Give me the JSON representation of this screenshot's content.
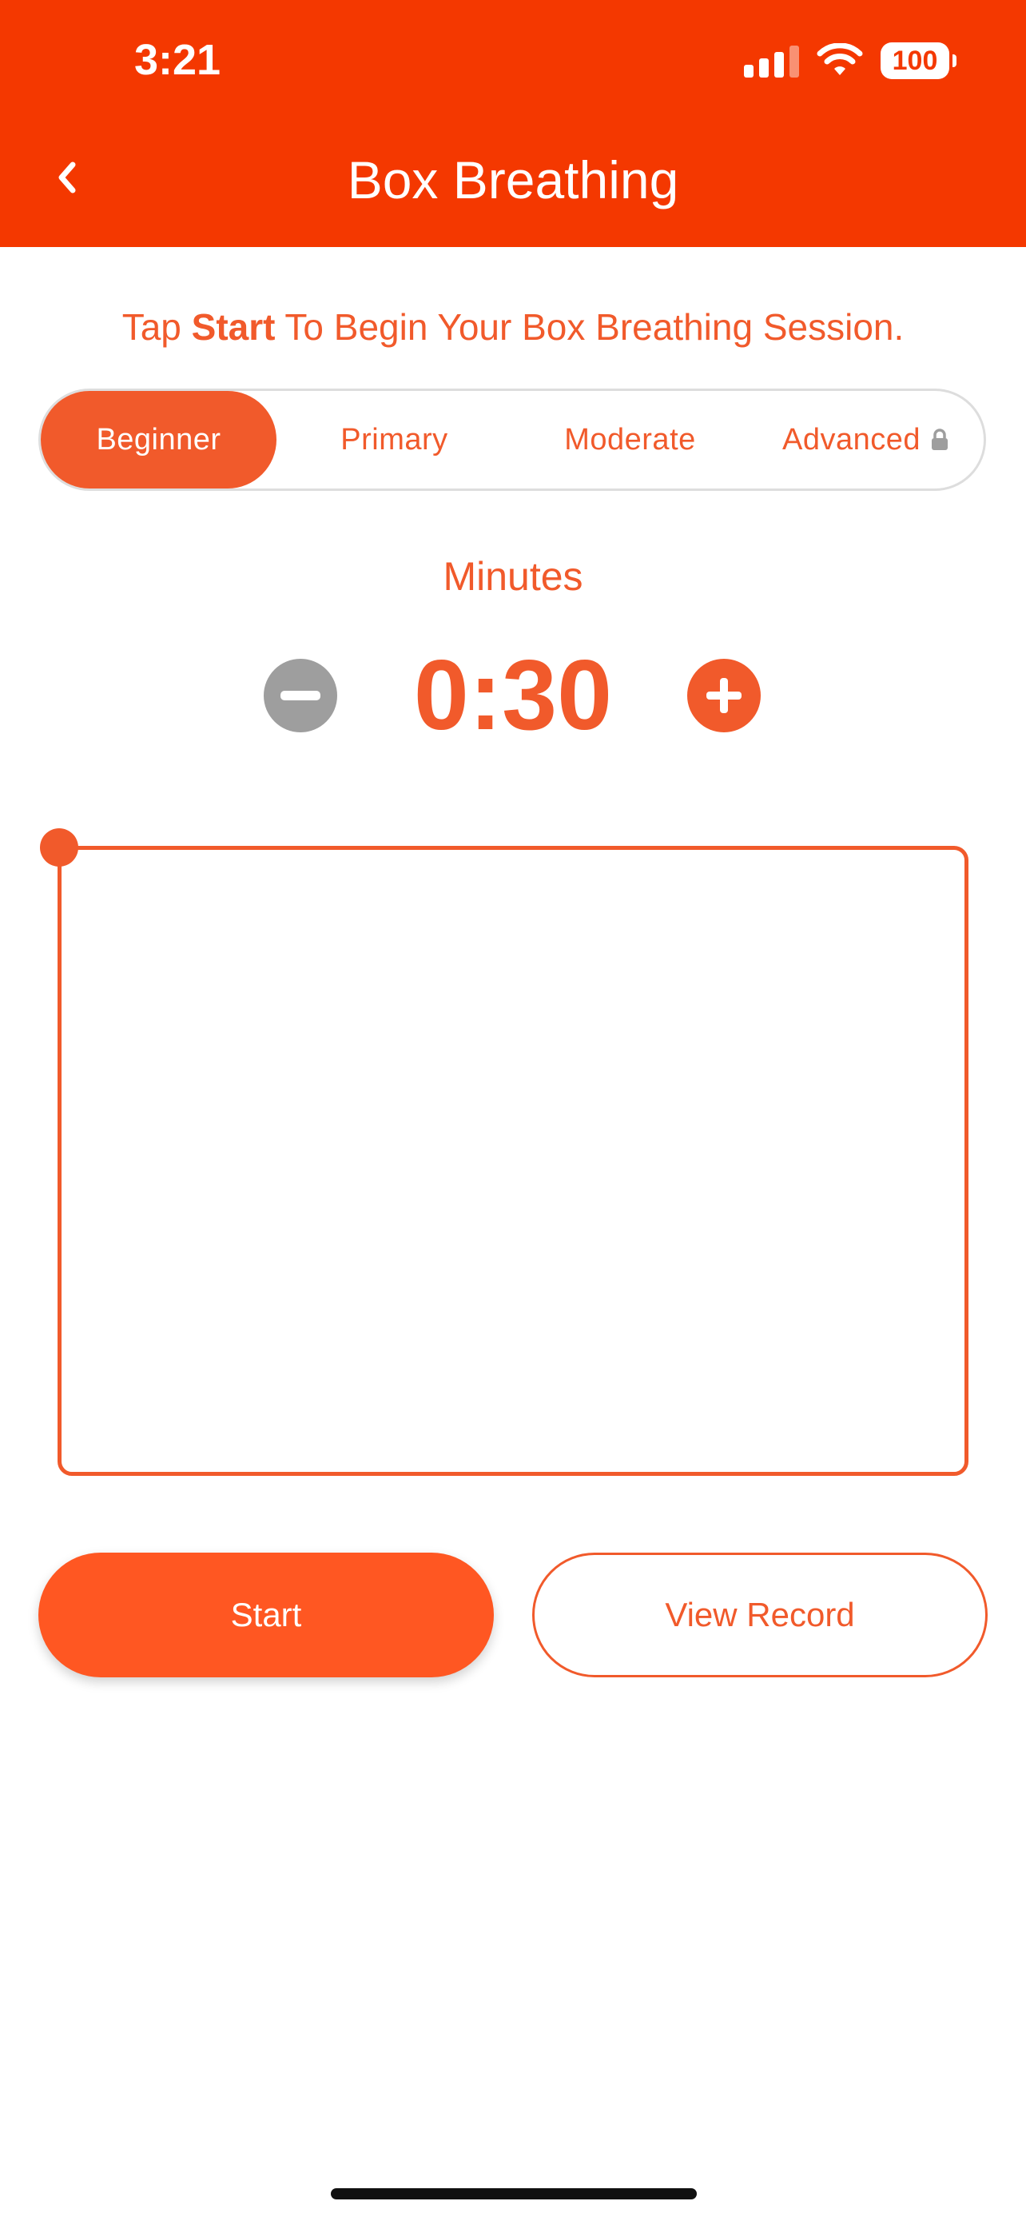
{
  "status_bar": {
    "time": "3:21",
    "battery": "100"
  },
  "header": {
    "title": "Box Breathing",
    "back_icon": "chevron-left-icon"
  },
  "instruction": {
    "prefix": "Tap ",
    "bold": "Start",
    "suffix": " To Begin Your Box Breathing Session."
  },
  "levels": {
    "selected": "Beginner",
    "items": [
      {
        "label": "Beginner",
        "locked": false
      },
      {
        "label": "Primary",
        "locked": false
      },
      {
        "label": "Moderate",
        "locked": false
      },
      {
        "label": "Advanced",
        "locked": true
      }
    ]
  },
  "timer": {
    "label": "Minutes",
    "value": "0:30",
    "decrement_icon": "minus-icon",
    "increment_icon": "plus-icon"
  },
  "actions": {
    "start_label": "Start",
    "record_label": "View Record"
  },
  "colors": {
    "header_bg": "#F43800",
    "accent": "#F15A2B",
    "start_button": "#FF5722",
    "disabled": "#9E9E9E"
  }
}
